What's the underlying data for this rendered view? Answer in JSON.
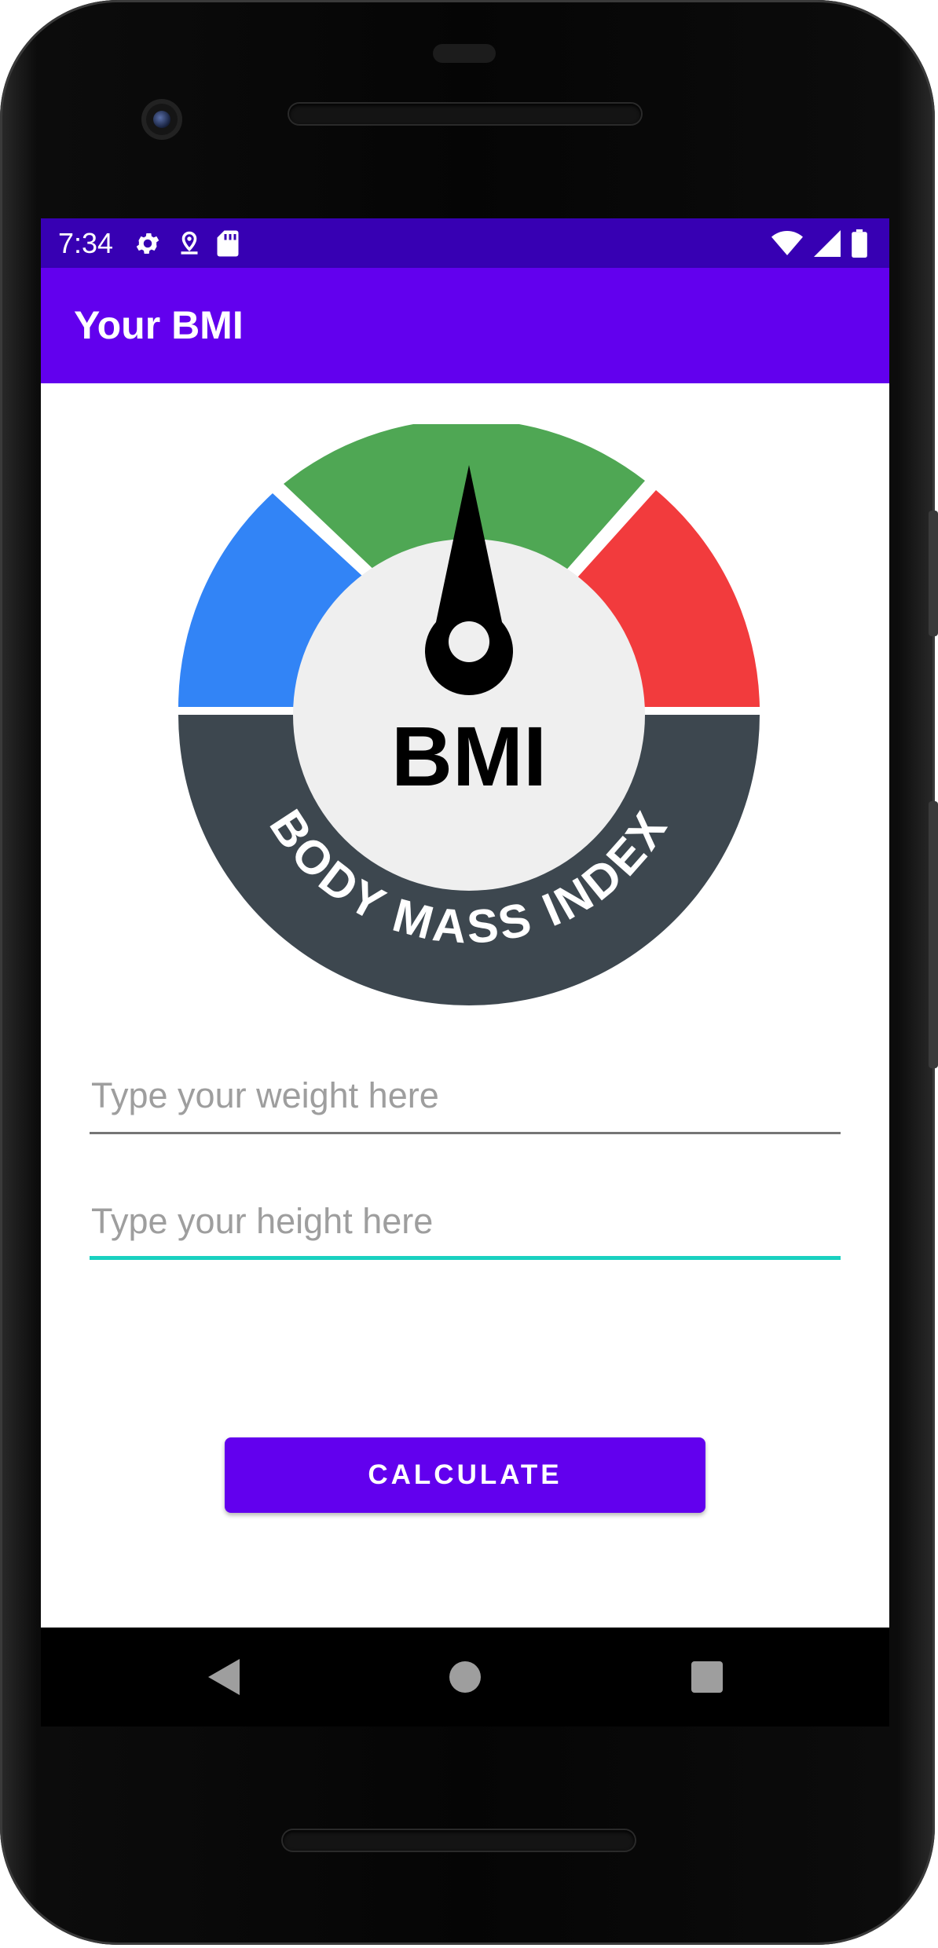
{
  "status_bar": {
    "time": "7:34",
    "left_icons": [
      "settings-icon",
      "location-pin-icon",
      "sd-card-icon"
    ],
    "right_icons": [
      "wifi-icon",
      "cell-signal-icon",
      "battery-icon"
    ]
  },
  "app_bar": {
    "title": "Your BMI"
  },
  "logo": {
    "center_text": "BMI",
    "arc_text": "BODY MASS INDEX",
    "colors": {
      "low": "#3284f6",
      "normal": "#4fa754",
      "high": "#f23b3d",
      "band": "#3d474f",
      "dial": "#efefef",
      "needle": "#000000"
    }
  },
  "form": {
    "weight": {
      "placeholder": "Type your weight here",
      "value": ""
    },
    "height": {
      "placeholder": "Type your height here",
      "value": "",
      "focused": true
    },
    "calculate_label": "CALCULATE"
  },
  "colors": {
    "primary": "#6200ee",
    "primary_dark": "#3700b3",
    "accent": "#19d1c0"
  },
  "nav_bar": {
    "icons": [
      "back-icon",
      "home-icon",
      "recents-icon"
    ]
  }
}
